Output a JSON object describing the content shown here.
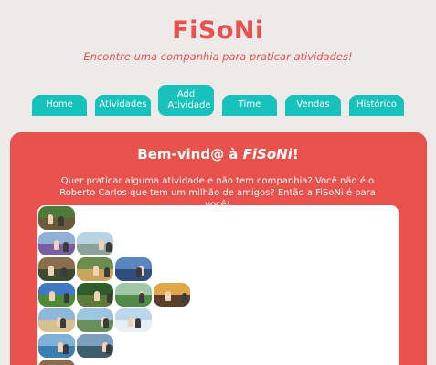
{
  "site": {
    "name": "FiSoNi",
    "tagline": "Encontre uma companhia para praticar atividades!"
  },
  "nav": {
    "items": [
      {
        "label": "Home"
      },
      {
        "label": "Atividades"
      },
      {
        "label": "Add Atividade",
        "active": true
      },
      {
        "label": "Time"
      },
      {
        "label": "Vendas"
      },
      {
        "label": "Histórico"
      }
    ]
  },
  "main": {
    "welcome_prefix": "Bem-vind@ à ",
    "welcome_brand": "FiSoNi",
    "welcome_suffix": "!",
    "intro": "Quer praticar alguma atividade e não tem companhia? Você não é o Roberto Carlos que tem um milhão de amigos? Então a FiSoNi é para você!"
  },
  "gallery": {
    "photos": [
      {
        "name": "photo-hiking-trail",
        "sky": "#4f7a3a",
        "ground": "#6b5a3b"
      },
      {
        "name": "photo-group-outdoors",
        "sky": "#8fb0d8",
        "ground": "#7a5fa0"
      },
      {
        "name": "photo-runners",
        "sky": "#b9d3e6",
        "ground": "#8da39a"
      },
      {
        "name": "photo-mountain-bike",
        "sky": "#8b6e4b",
        "ground": "#3c4a2f"
      },
      {
        "name": "photo-team-field",
        "sky": "#6b8e4e",
        "ground": "#c9a45c"
      },
      {
        "name": "photo-hang-gliding",
        "sky": "#5a86c2",
        "ground": "#2f4f7a"
      },
      {
        "name": "photo-paragliding",
        "sky": "#3f79c0",
        "ground": "#4d8a3a"
      },
      {
        "name": "photo-forest-climb",
        "sky": "#2e5c2a",
        "ground": "#5d7a3b"
      },
      {
        "name": "photo-soccer-players",
        "sky": "#a0c7a8",
        "ground": "#4f8a49"
      },
      {
        "name": "photo-sunset-group",
        "sky": "#e0a64a",
        "ground": "#5a3f2a"
      },
      {
        "name": "photo-beach-volley",
        "sky": "#8fb8d8",
        "ground": "#d8c08f"
      },
      {
        "name": "photo-friends-beach",
        "sky": "#9cc5e0",
        "ground": "#6a8f5a"
      },
      {
        "name": "photo-skiing",
        "sky": "#bcd6ee",
        "ground": "#e8eef5"
      },
      {
        "name": "photo-surfing",
        "sky": "#7fb2d6",
        "ground": "#3a7fb0"
      },
      {
        "name": "photo-lake-boats",
        "sky": "#7d9fbe",
        "ground": "#3e5e6e"
      },
      {
        "name": "photo-river-rafting",
        "sky": "#8c6a4a",
        "ground": "#6e8a9a"
      },
      {
        "name": "photo-rock-climbing",
        "sky": "#7ea0c0",
        "ground": "#6a6a5a"
      }
    ]
  }
}
